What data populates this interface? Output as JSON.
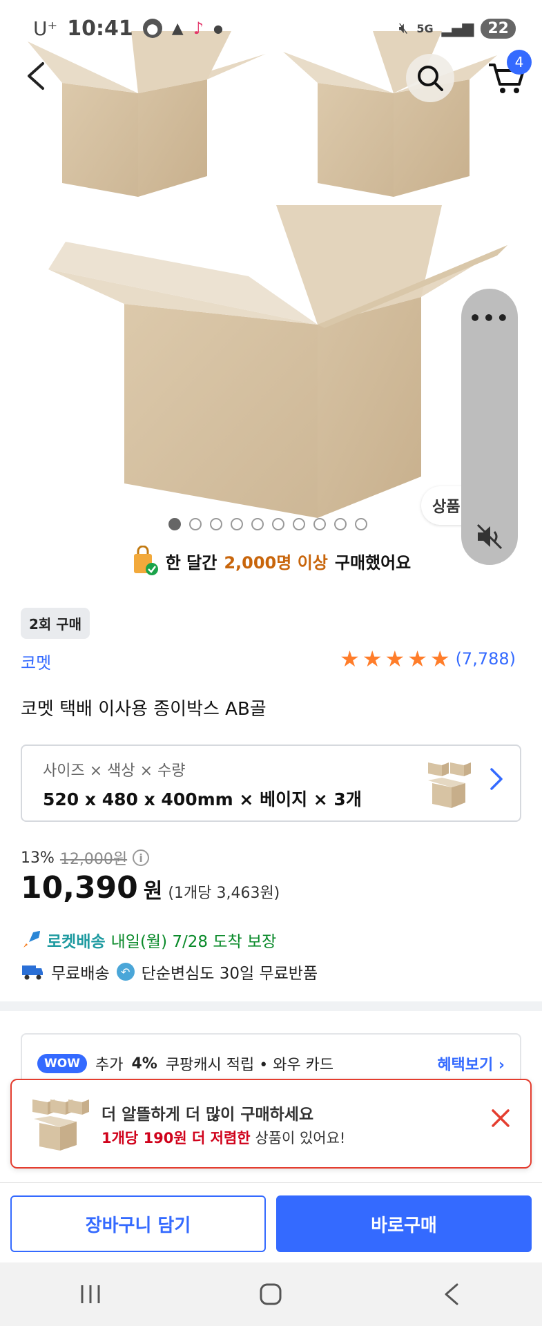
{
  "status_bar": {
    "carrier": "U⁺",
    "time": "10:41",
    "network": "5G",
    "battery": "22"
  },
  "floating_panel": {
    "more": "•••",
    "product_tab": "상품"
  },
  "carousel": {
    "total": 10,
    "active_index": 0
  },
  "social_proof": {
    "prefix": "한 달간",
    "highlight": "2,000명 이상",
    "suffix": "구매했어요"
  },
  "header": {
    "cart_count": "4"
  },
  "product": {
    "purchase_tag": "2회 구매",
    "brand": "코멧",
    "rating_count": "(7,788)",
    "rating": 5,
    "title": "코멧 택배 이사용 종이박스 AB골",
    "option_label": "사이즈 × 색상 × 수량",
    "option_value": "520 x 480 x 400mm × 베이지 × 3개",
    "discount_rate": "13%",
    "original_price": "12,000원",
    "price": "10,390",
    "price_unit": "원",
    "per_unit_price": "(1개당 3,463원)"
  },
  "delivery": {
    "rocket_label": "로켓배송",
    "arrival": "내일(월) 7/28 도착 보장",
    "free_shipping": "무료배송",
    "free_returns": "단순변심도 30일 무료반품"
  },
  "wow": {
    "badge": "WOW",
    "text_prefix": "추가",
    "text_rate": "4%",
    "text_suffix": "쿠팡캐시 적립  •  와우 카드",
    "link": "혜택보기 ›"
  },
  "popup": {
    "title": "더 알뜰하게 더 많이 구매하세요",
    "highlight": "1개당 190원 더 저렴한",
    "suffix": "상품이 있어요!"
  },
  "actions": {
    "add_to_cart": "장바구니 담기",
    "buy_now": "바로구매"
  },
  "colors": {
    "accent": "#346aff",
    "rocket_green": "#0a8a2a",
    "highlight_orange": "#c8650b",
    "alert_red": "#e43d2f",
    "star": "#ff7d2a"
  }
}
